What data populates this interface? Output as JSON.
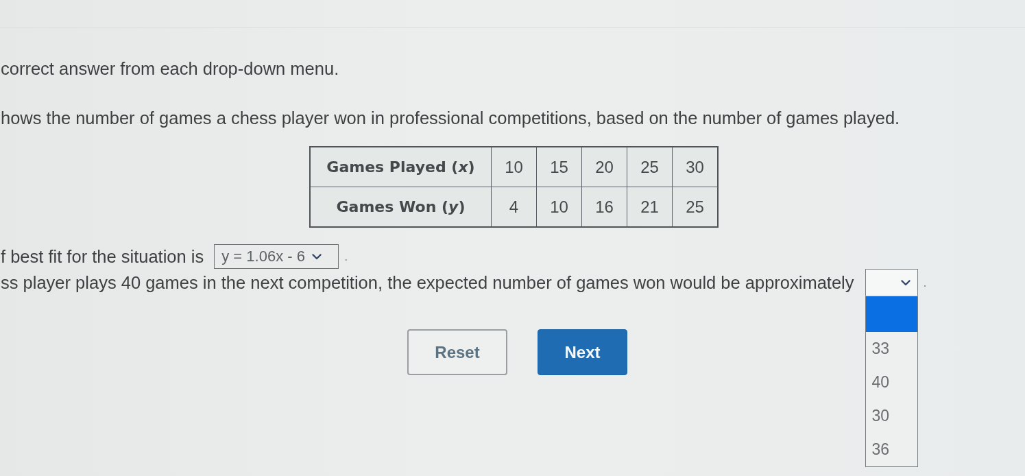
{
  "instructions": {
    "text": "correct answer from each drop-down menu."
  },
  "intro": {
    "text": "hows the number of games a chess player won in professional competitions, based on the number of games played."
  },
  "table": {
    "rows": [
      {
        "header": "Games Played (*x*)",
        "cells": [
          "10",
          "15",
          "20",
          "25",
          "30"
        ]
      },
      {
        "header": "Games Won (*y*)",
        "cells": [
          "4",
          "10",
          "16",
          "21",
          "25"
        ]
      }
    ]
  },
  "questions": [
    {
      "text": "f best fit for the situation is",
      "dropdown": {
        "value": "y = 1.06x - 6",
        "expanded": false
      },
      "end": "."
    },
    {
      "text": "ss player plays 40 games in the next competition, the expected number of games won would be approximately",
      "dropdown": {
        "expanded": true,
        "options": [
          {
            "selected": true
          },
          {
            "label": "33",
            "selected": false
          },
          {
            "label": "40",
            "selected": false
          },
          {
            "label": "30",
            "selected": false
          },
          {
            "label": "36",
            "selected": false
          }
        ]
      },
      "end": "."
    }
  ],
  "buttons": [
    {
      "label": "Reset",
      "kind": "secondary"
    },
    {
      "label": "Next",
      "kind": "primary"
    }
  ]
}
